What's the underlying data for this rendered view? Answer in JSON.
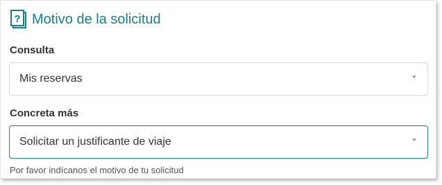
{
  "section": {
    "icon": "question-document-icon",
    "title": "Motivo de la solicitud",
    "accent_color": "#1a7d89"
  },
  "consulta": {
    "label": "Consulta",
    "selected": "Mis reservas"
  },
  "concreta": {
    "label": "Concreta más",
    "selected": "Solicitar un justificante de viaje",
    "hint": "Por favor indícanos el motivo de tu solicitud"
  }
}
